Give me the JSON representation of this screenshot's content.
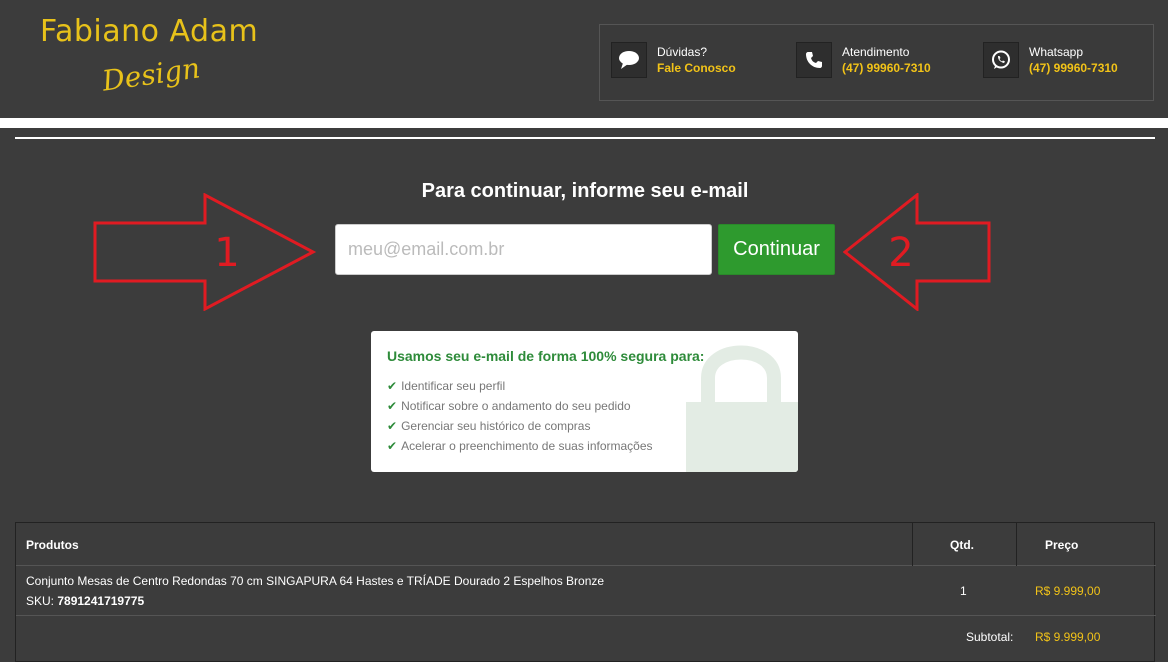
{
  "brand": {
    "name": "Fabiano Adam",
    "sub": "Design",
    "color": "#e8c21a"
  },
  "contacts": [
    {
      "icon": "chat-bubble-icon",
      "label": "Dúvidas?",
      "value": "Fale Conosco"
    },
    {
      "icon": "phone-icon",
      "label": "Atendimento",
      "value": "(47) 99960-7310"
    },
    {
      "icon": "whatsapp-icon",
      "label": "Whatsapp",
      "value": "(47) 99960-7310"
    }
  ],
  "form": {
    "prompt": "Para continuar, informe seu e-mail",
    "email_placeholder": "meu@email.com.br",
    "email_value": "",
    "continue_label": "Continuar",
    "accent": "#2e9a2e"
  },
  "annotations": {
    "arrow_left_number": "1",
    "arrow_right_number": "2",
    "color": "#e01b22"
  },
  "security": {
    "title": "Usamos seu e-mail de forma 100% segura para:",
    "items": [
      "Identificar seu perfil",
      "Notificar sobre o andamento do seu pedido",
      "Gerenciar seu histórico de compras",
      "Acelerar o preenchimento de suas informações"
    ]
  },
  "cart": {
    "headers": {
      "products": "Produtos",
      "qty": "Qtd.",
      "price": "Preço"
    },
    "items": [
      {
        "name": "Conjunto Mesas de Centro Redondas 70 cm SINGAPURA 64 Hastes e TRÍADE Dourado 2 Espelhos Bronze",
        "sku_label": "SKU:",
        "sku": "7891241719775",
        "qty": "1",
        "price": "R$ 9.999,00"
      }
    ],
    "subtotal_label": "Subtotal:",
    "subtotal_value": "R$ 9.999,00"
  }
}
